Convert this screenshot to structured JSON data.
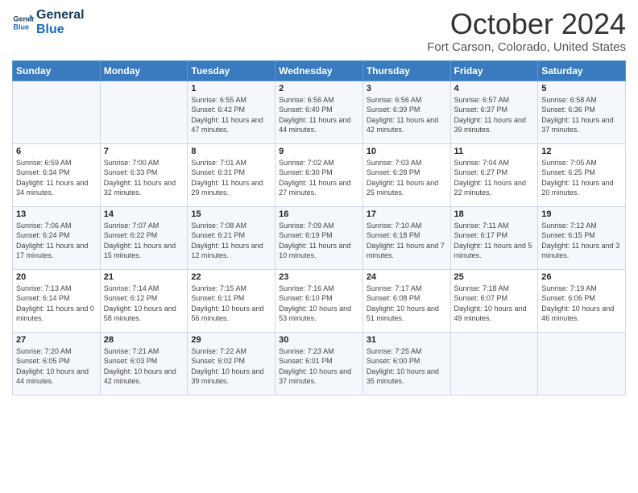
{
  "header": {
    "logo_line1": "General",
    "logo_line2": "Blue",
    "month": "October 2024",
    "location": "Fort Carson, Colorado, United States"
  },
  "days_of_week": [
    "Sunday",
    "Monday",
    "Tuesday",
    "Wednesday",
    "Thursday",
    "Friday",
    "Saturday"
  ],
  "weeks": [
    [
      {
        "num": "",
        "info": ""
      },
      {
        "num": "",
        "info": ""
      },
      {
        "num": "1",
        "info": "Sunrise: 6:55 AM\nSunset: 6:42 PM\nDaylight: 11 hours and 47 minutes."
      },
      {
        "num": "2",
        "info": "Sunrise: 6:56 AM\nSunset: 6:40 PM\nDaylight: 11 hours and 44 minutes."
      },
      {
        "num": "3",
        "info": "Sunrise: 6:56 AM\nSunset: 6:39 PM\nDaylight: 11 hours and 42 minutes."
      },
      {
        "num": "4",
        "info": "Sunrise: 6:57 AM\nSunset: 6:37 PM\nDaylight: 11 hours and 39 minutes."
      },
      {
        "num": "5",
        "info": "Sunrise: 6:58 AM\nSunset: 6:36 PM\nDaylight: 11 hours and 37 minutes."
      }
    ],
    [
      {
        "num": "6",
        "info": "Sunrise: 6:59 AM\nSunset: 6:34 PM\nDaylight: 11 hours and 34 minutes."
      },
      {
        "num": "7",
        "info": "Sunrise: 7:00 AM\nSunset: 6:33 PM\nDaylight: 11 hours and 32 minutes."
      },
      {
        "num": "8",
        "info": "Sunrise: 7:01 AM\nSunset: 6:31 PM\nDaylight: 11 hours and 29 minutes."
      },
      {
        "num": "9",
        "info": "Sunrise: 7:02 AM\nSunset: 6:30 PM\nDaylight: 11 hours and 27 minutes."
      },
      {
        "num": "10",
        "info": "Sunrise: 7:03 AM\nSunset: 6:28 PM\nDaylight: 11 hours and 25 minutes."
      },
      {
        "num": "11",
        "info": "Sunrise: 7:04 AM\nSunset: 6:27 PM\nDaylight: 11 hours and 22 minutes."
      },
      {
        "num": "12",
        "info": "Sunrise: 7:05 AM\nSunset: 6:25 PM\nDaylight: 11 hours and 20 minutes."
      }
    ],
    [
      {
        "num": "13",
        "info": "Sunrise: 7:06 AM\nSunset: 6:24 PM\nDaylight: 11 hours and 17 minutes."
      },
      {
        "num": "14",
        "info": "Sunrise: 7:07 AM\nSunset: 6:22 PM\nDaylight: 11 hours and 15 minutes."
      },
      {
        "num": "15",
        "info": "Sunrise: 7:08 AM\nSunset: 6:21 PM\nDaylight: 11 hours and 12 minutes."
      },
      {
        "num": "16",
        "info": "Sunrise: 7:09 AM\nSunset: 6:19 PM\nDaylight: 11 hours and 10 minutes."
      },
      {
        "num": "17",
        "info": "Sunrise: 7:10 AM\nSunset: 6:18 PM\nDaylight: 11 hours and 7 minutes."
      },
      {
        "num": "18",
        "info": "Sunrise: 7:11 AM\nSunset: 6:17 PM\nDaylight: 11 hours and 5 minutes."
      },
      {
        "num": "19",
        "info": "Sunrise: 7:12 AM\nSunset: 6:15 PM\nDaylight: 11 hours and 3 minutes."
      }
    ],
    [
      {
        "num": "20",
        "info": "Sunrise: 7:13 AM\nSunset: 6:14 PM\nDaylight: 11 hours and 0 minutes."
      },
      {
        "num": "21",
        "info": "Sunrise: 7:14 AM\nSunset: 6:12 PM\nDaylight: 10 hours and 58 minutes."
      },
      {
        "num": "22",
        "info": "Sunrise: 7:15 AM\nSunset: 6:11 PM\nDaylight: 10 hours and 56 minutes."
      },
      {
        "num": "23",
        "info": "Sunrise: 7:16 AM\nSunset: 6:10 PM\nDaylight: 10 hours and 53 minutes."
      },
      {
        "num": "24",
        "info": "Sunrise: 7:17 AM\nSunset: 6:08 PM\nDaylight: 10 hours and 51 minutes."
      },
      {
        "num": "25",
        "info": "Sunrise: 7:18 AM\nSunset: 6:07 PM\nDaylight: 10 hours and 49 minutes."
      },
      {
        "num": "26",
        "info": "Sunrise: 7:19 AM\nSunset: 6:06 PM\nDaylight: 10 hours and 46 minutes."
      }
    ],
    [
      {
        "num": "27",
        "info": "Sunrise: 7:20 AM\nSunset: 6:05 PM\nDaylight: 10 hours and 44 minutes."
      },
      {
        "num": "28",
        "info": "Sunrise: 7:21 AM\nSunset: 6:03 PM\nDaylight: 10 hours and 42 minutes."
      },
      {
        "num": "29",
        "info": "Sunrise: 7:22 AM\nSunset: 6:02 PM\nDaylight: 10 hours and 39 minutes."
      },
      {
        "num": "30",
        "info": "Sunrise: 7:23 AM\nSunset: 6:01 PM\nDaylight: 10 hours and 37 minutes."
      },
      {
        "num": "31",
        "info": "Sunrise: 7:25 AM\nSunset: 6:00 PM\nDaylight: 10 hours and 35 minutes."
      },
      {
        "num": "",
        "info": ""
      },
      {
        "num": "",
        "info": ""
      }
    ]
  ]
}
